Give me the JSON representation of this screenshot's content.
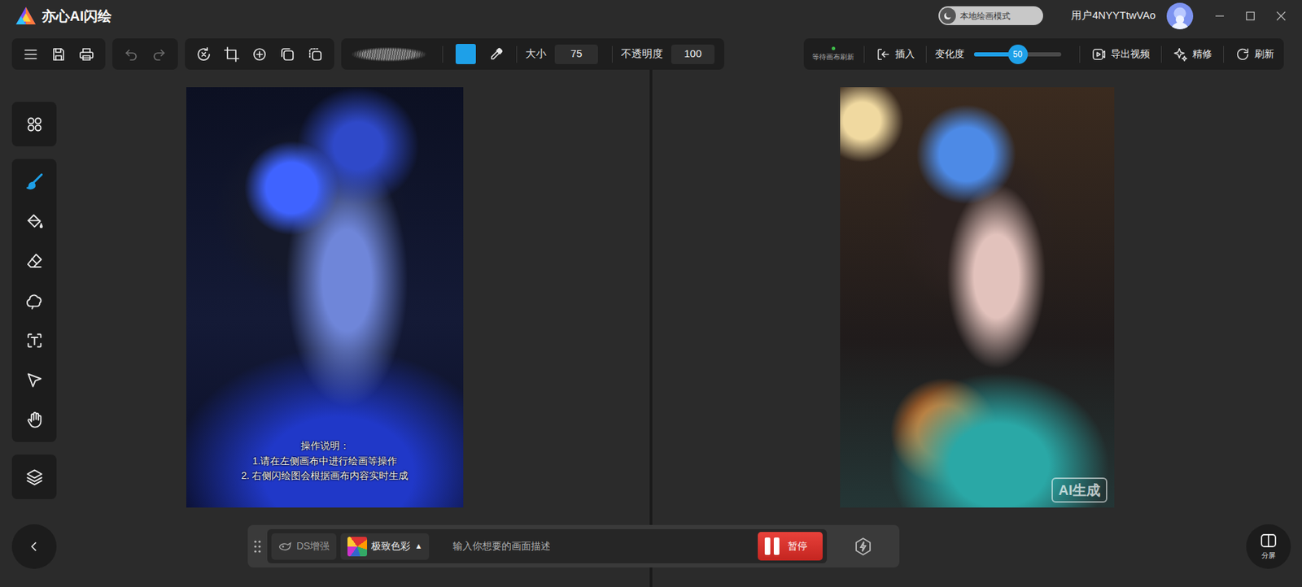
{
  "app": {
    "title": "亦心AI闪绘",
    "mode": {
      "label": "本地绘画模式",
      "on": false
    },
    "user": "用户4NYYTtwVAo"
  },
  "toolbar": {
    "file": [
      {
        "kind": "menu"
      },
      {
        "kind": "save"
      },
      {
        "kind": "print"
      }
    ],
    "history": [
      {
        "kind": "undo",
        "disabled": true
      },
      {
        "kind": "redo",
        "disabled": true
      }
    ],
    "transform": [
      {
        "kind": "rotate"
      },
      {
        "kind": "crop"
      },
      {
        "kind": "add"
      },
      {
        "kind": "duplicate"
      },
      {
        "kind": "stack"
      }
    ],
    "brush": {
      "color": "#1ea0e8",
      "size": {
        "label": "大小",
        "value": "75"
      },
      "opacity": {
        "label": "不透明度",
        "value": "100"
      }
    },
    "status": {
      "label": "等待画布刷新"
    },
    "insert": {
      "label": "插入"
    },
    "variation": {
      "label": "变化度",
      "level": 0.5,
      "reading": "50"
    },
    "actions": [
      {
        "kind": "export",
        "label": "导出视频"
      },
      {
        "kind": "refine",
        "label": "精修"
      },
      {
        "kind": "refresh",
        "label": "刷新"
      }
    ]
  },
  "sidebar": {
    "groups": [
      [
        {
          "kind": "assets",
          "selected": false
        }
      ],
      [
        {
          "kind": "brush",
          "selected": true
        },
        {
          "kind": "fill",
          "selected": false
        },
        {
          "kind": "eraser",
          "selected": false
        },
        {
          "kind": "lasso",
          "selected": false
        },
        {
          "kind": "text",
          "selected": false
        },
        {
          "kind": "select",
          "selected": false
        },
        {
          "kind": "hand",
          "selected": false
        }
      ],
      [
        {
          "kind": "layers",
          "selected": false
        }
      ]
    ]
  },
  "canvas": {
    "instructions": [
      "操作说明：",
      "1.请在左侧画布中进行绘画等操作",
      "2. 右侧闪绘图会根据画布内容实时生成"
    ]
  },
  "preview": {
    "watermark": "AI生成"
  },
  "prompt_bar": {
    "enhance": {
      "label": "DS增强",
      "on": false
    },
    "style": {
      "label": "极致色彩",
      "arrow": "▲"
    },
    "placeholder": "输入你想要的画面描述",
    "pause": "暂停"
  },
  "split": {
    "label": "分屏"
  }
}
